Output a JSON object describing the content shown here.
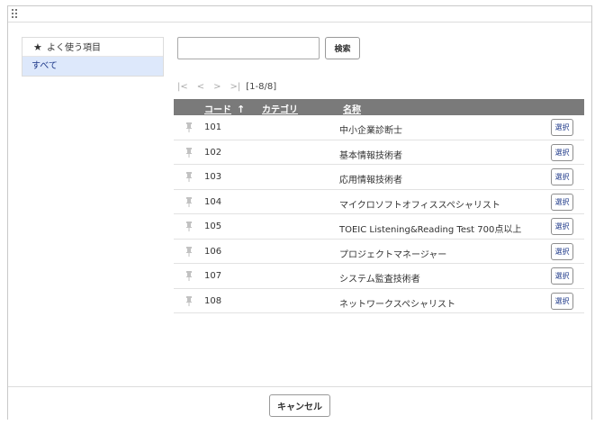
{
  "sidebar": {
    "items": [
      {
        "label": "よく使う項目",
        "icon": "star-icon",
        "selected": false
      },
      {
        "label": "すべて",
        "selected": true
      }
    ]
  },
  "search": {
    "value": "",
    "placeholder": "",
    "button_label": "検索"
  },
  "pager": {
    "first": "|<",
    "prev": "<",
    "next": ">",
    "last": ">|",
    "range": "[1-8/8]"
  },
  "table": {
    "headers": {
      "code": "コード",
      "category": "カテゴリ",
      "name": "名称"
    },
    "sort_icon": "arrow-up-icon",
    "rows": [
      {
        "code": "101",
        "category": "",
        "name": "中小企業診断士",
        "action": "選択"
      },
      {
        "code": "102",
        "category": "",
        "name": "基本情報技術者",
        "action": "選択"
      },
      {
        "code": "103",
        "category": "",
        "name": "応用情報技術者",
        "action": "選択"
      },
      {
        "code": "104",
        "category": "",
        "name": "マイクロソフトオフィススペシャリスト",
        "action": "選択"
      },
      {
        "code": "105",
        "category": "",
        "name": "TOEIC Listening&Reading Test 700点以上",
        "action": "選択"
      },
      {
        "code": "106",
        "category": "",
        "name": "プロジェクトマネージャー",
        "action": "選択"
      },
      {
        "code": "107",
        "category": "",
        "name": "システム監査技術者",
        "action": "選択"
      },
      {
        "code": "108",
        "category": "",
        "name": "ネットワークスペシャリスト",
        "action": "選択"
      }
    ]
  },
  "footer": {
    "cancel_label": "キャンセル"
  },
  "colors": {
    "header_bg": "#7a7a7a",
    "selected_bg": "#dde8fb",
    "accent": "#1f3a8a"
  }
}
